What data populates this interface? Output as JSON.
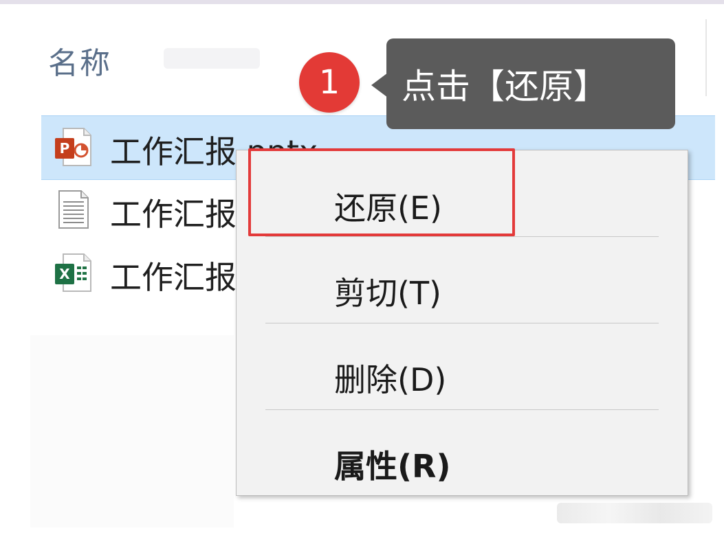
{
  "column_header": "名称",
  "files": [
    {
      "name": "工作汇报.pptx",
      "icon": "powerpoint-file-icon",
      "selected": true
    },
    {
      "name": "工作汇报",
      "icon": "text-file-icon",
      "selected": false
    },
    {
      "name": "工作汇报",
      "icon": "excel-file-icon",
      "selected": false
    }
  ],
  "annotation": {
    "step_number": "1",
    "tooltip_text": "点击【还原】",
    "accent_color": "#e33a36",
    "highlight_color": "#e33a3a"
  },
  "context_menu": {
    "items": [
      {
        "label": "还原(E)",
        "bold": false
      },
      {
        "label": "剪切(T)",
        "bold": false
      },
      {
        "label": "删除(D)",
        "bold": false
      },
      {
        "label": "属性(R)",
        "bold": true
      }
    ]
  },
  "colors": {
    "selection_background": "#cde6fb",
    "tooltip_background": "#5b5b5b",
    "menu_background": "#f2f2f2"
  }
}
